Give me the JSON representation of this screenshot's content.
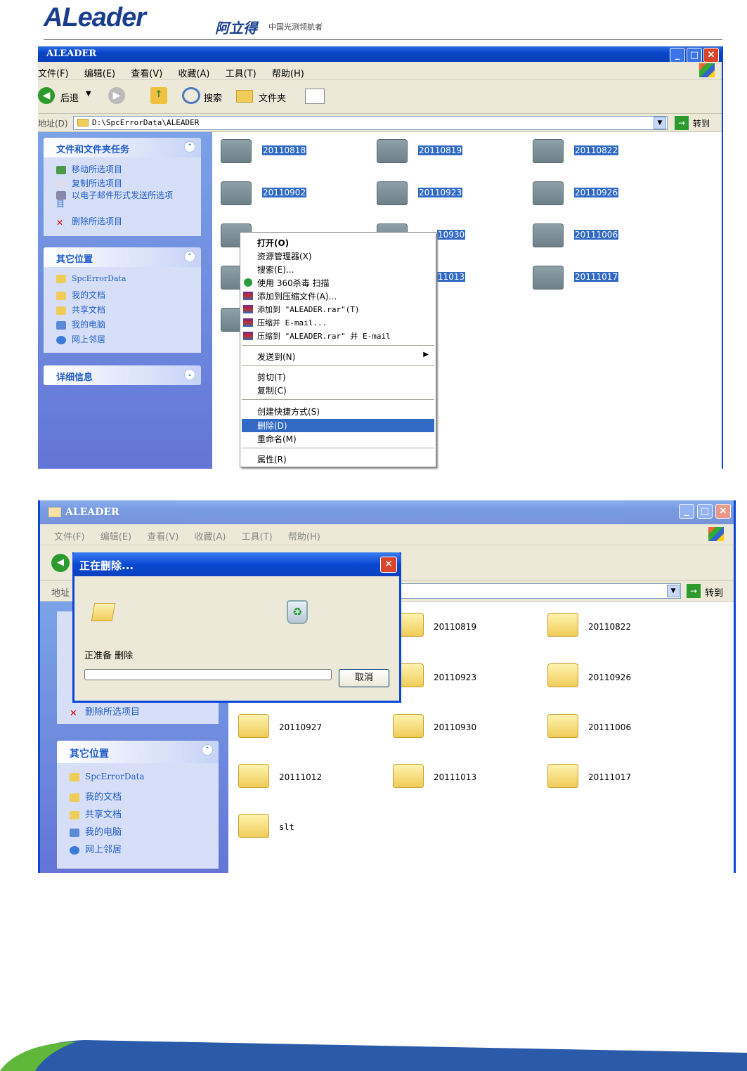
{
  "brand": {
    "logo_text": "ALeader",
    "name_cn": "阿立得",
    "slogan": "中国光测领航者"
  },
  "explorer1": {
    "title": "ALEADER",
    "menu": [
      "文件(F)",
      "编辑(E)",
      "查看(V)",
      "收藏(A)",
      "工具(T)",
      "帮助(H)"
    ],
    "toolbar": {
      "back": "后退",
      "search": "搜索",
      "folders": "文件夹"
    },
    "address_label": "地址(D)",
    "address": "D:\\SpcErrorData\\ALEADER",
    "go": "转到",
    "tasks_title": "文件和文件夹任务",
    "tasks": [
      "移动所选项目",
      "复制所选项目",
      "以电子邮件形式发送所选项目",
      "删除所选项目"
    ],
    "places_title": "其它位置",
    "places": [
      "SpcErrorData",
      "我的文档",
      "共享文档",
      "我的电脑",
      "网上邻居"
    ],
    "details_title": "详细信息",
    "folders": [
      "20110818",
      "20110819",
      "20110822",
      "20110902",
      "20110923",
      "20110926",
      "20111006",
      "20111017"
    ],
    "partial_labels": [
      "10930",
      "11013"
    ]
  },
  "context_menu": {
    "items": [
      "打开(O)",
      "资源管理器(X)",
      "搜索(E)...",
      "使用 360杀毒 扫描",
      "添加到压缩文件(A)...",
      "添加到 \"ALEADER.rar\"(T)",
      "压缩并 E-mail...",
      "压缩到 \"ALEADER.rar\" 并 E-mail",
      "发送到(N)",
      "剪切(T)",
      "复制(C)",
      "创建快捷方式(S)",
      "删除(D)",
      "重命名(M)",
      "属性(R)"
    ]
  },
  "explorer2": {
    "title": "ALEADER",
    "menu": [
      "文件(F)",
      "编辑(E)",
      "查看(V)",
      "收藏(A)",
      "工具(T)",
      "帮助(H)"
    ],
    "address_label": "地址",
    "go": "转到",
    "task_visible": "删除所选项目",
    "places_title": "其它位置",
    "places": [
      "SpcErrorData",
      "我的文档",
      "共享文档",
      "我的电脑",
      "网上邻居"
    ],
    "folders": [
      "20110819",
      "20110822",
      "20110923",
      "20110926",
      "20110927",
      "20110930",
      "20111006",
      "20111012",
      "20111013",
      "20111017",
      "slt"
    ]
  },
  "dialog": {
    "title": "正在删除...",
    "status": "正准备 删除",
    "cancel": "取消",
    "progress": 0
  },
  "colors": {
    "xp_blue": "#0a46d8",
    "selection": "#316ac5",
    "brand_blue": "#1a3e8c"
  }
}
